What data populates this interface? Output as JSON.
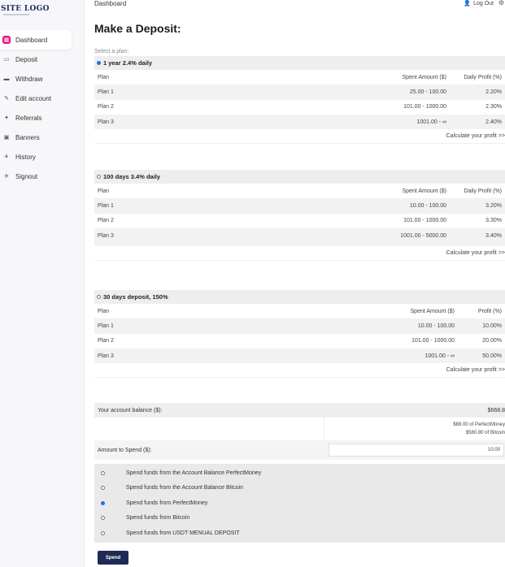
{
  "brand": {
    "logo_text": "SITE LOGO"
  },
  "topbar": {
    "title": "Dashboard",
    "logout_label": "Log Out"
  },
  "sidebar": {
    "items": [
      {
        "label": "Dashboard",
        "icon": "dashboard-icon",
        "active": true
      },
      {
        "label": "Deposit",
        "icon": "deposit-icon"
      },
      {
        "label": "Withdraw",
        "icon": "withdraw-icon"
      },
      {
        "label": "Edit account",
        "icon": "edit-icon"
      },
      {
        "label": "Referrals",
        "icon": "referrals-icon"
      },
      {
        "label": "Banners",
        "icon": "banners-icon"
      },
      {
        "label": "History",
        "icon": "history-icon"
      },
      {
        "label": "Signout",
        "icon": "signout-icon"
      }
    ]
  },
  "main": {
    "title": "Make a Deposit:",
    "select_label": "Select a plan:",
    "calc_label": "Calculate your profit >>",
    "groups": [
      {
        "name": "1 year 2.4% daily",
        "selected": true,
        "headers": [
          "Plan",
          "Spent Amount ($)",
          "Daily Profit (%)"
        ],
        "rows": [
          [
            "Plan 1",
            "25.00 - 100.00",
            "2.20%"
          ],
          [
            "Plan 2",
            "101.00 - 1000.00",
            "2.30%"
          ],
          [
            "Plan 3",
            "1001.00 - ∞",
            "2.40%"
          ]
        ]
      },
      {
        "name": "100 days 3.4% daily",
        "selected": false,
        "headers": [
          "Plan",
          "Spent Amount ($)",
          "Daily Profit (%)"
        ],
        "rows": [
          [
            "Plan 1",
            "10.00 - 100.00",
            "3.20%"
          ],
          [
            "Plan 2",
            "101.00 - 1000.00",
            "3.30%"
          ],
          [
            "Plan 3",
            "1001.00 - 5000.00",
            "3.40%"
          ]
        ]
      },
      {
        "name": "30 days deposit, 150%",
        "selected": false,
        "headers": [
          "Plan",
          "Spent Amount ($)",
          "Profit (%)"
        ],
        "rows": [
          [
            "Plan 1",
            "10.00 - 100.00",
            "10.00%"
          ],
          [
            "Plan 2",
            "101.00 - 1000.00",
            "20.00%"
          ],
          [
            "Plan 3",
            "1001.00 - ∞",
            "50.00%"
          ]
        ]
      }
    ]
  },
  "balance": {
    "label": "Your account balance ($):",
    "value": "$668.8",
    "breakdown_1": "$88.00 of PerfectMoney",
    "breakdown_2": "$580.80 of Bitcoin",
    "amount_label": "Amount to Spend ($):",
    "amount_value": "10.00"
  },
  "funding_options": [
    {
      "label": "Spend funds from the Account Balance PerfectMoney",
      "selected": false
    },
    {
      "label": "Spend funds from the Account Balance Bitcoin",
      "selected": false
    },
    {
      "label": "Spend funds from PerfectMoney",
      "selected": true
    },
    {
      "label": "Spend funds from Bitcoin",
      "selected": false
    },
    {
      "label": "Spend funds from USDT MENUAL DEPOSIT",
      "selected": false
    }
  ],
  "spend_button": "Spend",
  "colors": {
    "accent": "#e5127d",
    "button": "#1e2a55",
    "radio_on": "#1a73e8"
  }
}
